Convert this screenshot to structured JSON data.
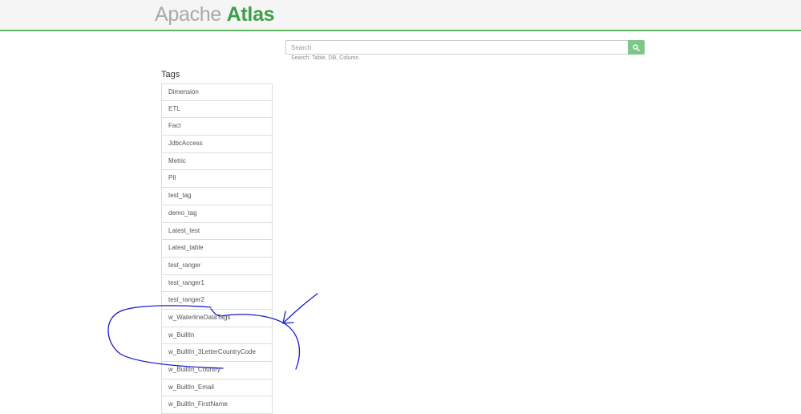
{
  "header": {
    "logo_light": "Apache",
    "logo_bold": "Atlas",
    "accent_color": "#5cb85c"
  },
  "search": {
    "placeholder": "Search",
    "button_icon": "search-icon",
    "hint": "Search: Table, DB, Column"
  },
  "tags": {
    "heading": "Tags",
    "items": [
      "Dimension",
      "ETL",
      "Fact",
      "JdbcAccess",
      "Metric",
      "PII",
      "test_tag",
      "demo_tag",
      "Latest_test",
      "Latest_table",
      "test_ranger",
      "test_ranger1",
      "test_ranger2",
      "w_WaterlineDataTags",
      "w_BuiltIn",
      "w_BuiltIn_3LetterCountryCode",
      "w_BuiltIn_Country",
      "w_BuiltIn_Email",
      "w_BuiltIn_FirstName"
    ]
  },
  "annotation": {
    "color": "#1a1acc"
  }
}
